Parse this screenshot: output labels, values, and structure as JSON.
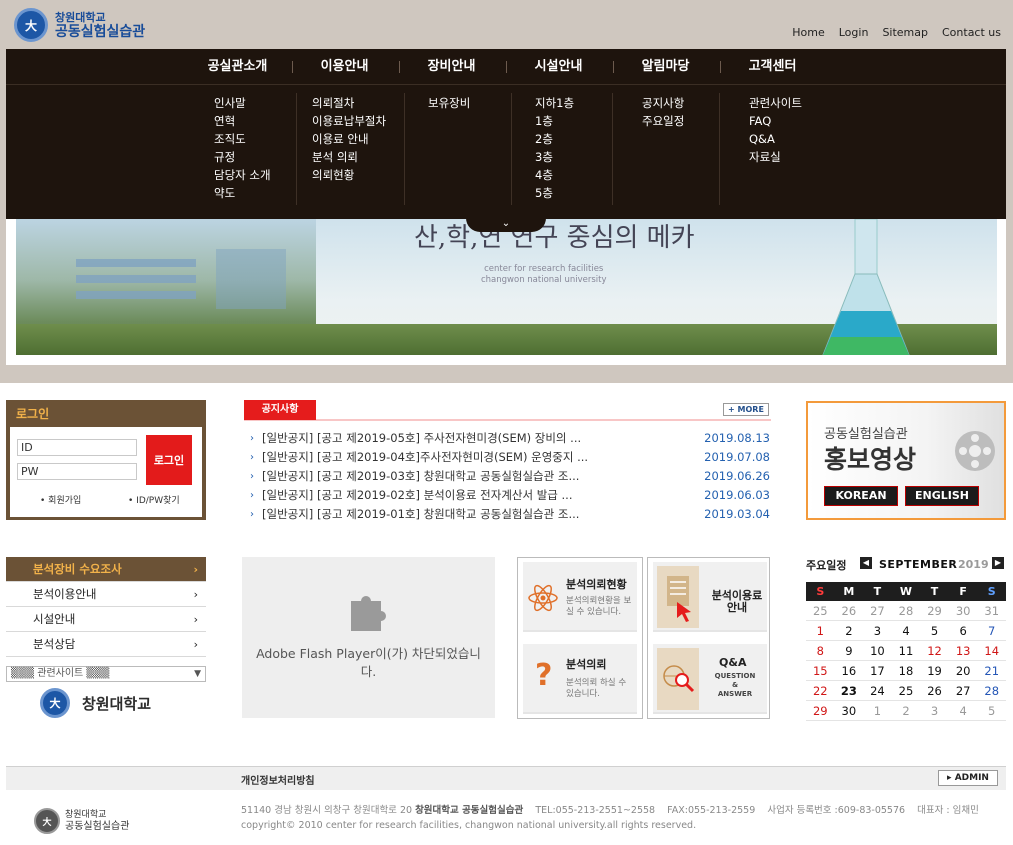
{
  "site": {
    "logo_line1": "창원대학교",
    "logo_line2": "공동실험실습관"
  },
  "util_links": [
    "Home",
    "Login",
    "Sitemap",
    "Contact us"
  ],
  "menu": [
    {
      "label": "공실관소개",
      "items": [
        "인사말",
        "연혁",
        "조직도",
        "규정",
        "담당자 소개",
        "약도"
      ]
    },
    {
      "label": "이용안내",
      "items": [
        "의뢰절차",
        "이용료납부절차",
        "이용료 안내",
        "분석 의뢰",
        "의뢰현황"
      ]
    },
    {
      "label": "장비안내",
      "items": [
        "보유장비"
      ]
    },
    {
      "label": "시설안내",
      "items": [
        "지하1층",
        "1층",
        "2층",
        "3층",
        "4층",
        "5층"
      ]
    },
    {
      "label": "알림마당",
      "items": [
        "공지사항",
        "주요일정"
      ]
    },
    {
      "label": "고객센터",
      "items": [
        "관련사이트",
        "FAQ",
        "Q&A",
        "자료실"
      ]
    }
  ],
  "banner": {
    "slogan": "산,학,연 연구 중심의 메카",
    "sub1": "center for research facilities",
    "sub2": "changwon national university"
  },
  "login": {
    "title": "로그인",
    "id_placeholder": "ID",
    "pw_placeholder": "PW",
    "button": "로그인",
    "join": "회원가입",
    "find": "ID/PW찾기"
  },
  "notice": {
    "tab": "공지사항",
    "more": "MORE",
    "items": [
      {
        "title": "[일반공지] [공고 제2019-05호] 주사전자현미경(SEM) 장비의 ...",
        "date": "2019.08.13"
      },
      {
        "title": "[일반공지] [공고 제2019-04호]주사전자현미경(SEM) 운영중지 ...",
        "date": "2019.07.08"
      },
      {
        "title": "[일반공지] [공고 제2019-03호] 창원대학교 공동실험실습관 조...",
        "date": "2019.06.26"
      },
      {
        "title": "[일반공지] [공고 제2019-02호] 분석이용료 전자계산서 발급 ...",
        "date": "2019.06.03"
      },
      {
        "title": "[일반공지] [공고 제2019-01호] 창원대학교 공동실험실습관 조...",
        "date": "2019.03.04"
      }
    ]
  },
  "promo": {
    "line1": "공동실험실습관",
    "line2": "홍보영상",
    "btn_korean": "KOREAN",
    "btn_english": "ENGLISH"
  },
  "left_menu": [
    {
      "label": "분석장비 수요조사"
    },
    {
      "label": "분석이용안내"
    },
    {
      "label": "시설안내"
    },
    {
      "label": "분석상담"
    }
  ],
  "related_select": "▒▒▒ 관련사이트 ▒▒▒",
  "univ_logo_text": "창원대학교",
  "flash_msg": "Adobe Flash Player이(가) 차단되었습니다.",
  "services": {
    "status": {
      "title": "분석의뢰현황",
      "desc": "분석의뢰현황을 보실 수 있습니다."
    },
    "request": {
      "title": "분석의뢰",
      "desc": "분석의뢰 하실 수 있습니다."
    },
    "fee": {
      "title": "분석이용료 안내"
    },
    "qa": {
      "title": "Q&A",
      "sub1": "QUESTION",
      "sub2": "&",
      "sub3": "ANSWER"
    }
  },
  "calendar": {
    "title": "주요일정",
    "month": "SEPTEMBER",
    "year": "2019",
    "weekdays": [
      "S",
      "M",
      "T",
      "W",
      "T",
      "F",
      "S"
    ],
    "weeks": [
      [
        "25",
        "26",
        "27",
        "28",
        "29",
        "30",
        "31"
      ],
      [
        "1",
        "2",
        "3",
        "4",
        "5",
        "6",
        "7"
      ],
      [
        "8",
        "9",
        "10",
        "11",
        "12",
        "13",
        "14"
      ],
      [
        "15",
        "16",
        "17",
        "18",
        "19",
        "20",
        "21"
      ],
      [
        "22",
        "23",
        "24",
        "25",
        "26",
        "27",
        "28"
      ],
      [
        "29",
        "30",
        "1",
        "2",
        "3",
        "4",
        "5"
      ]
    ]
  },
  "footer": {
    "privacy": "개인정보처리방침",
    "admin": "ADMIN",
    "logo_line1": "창원대학교",
    "logo_line2": "공동실험실습관",
    "addr_pre": "51140 경남 창원시 의창구 창원대학로 20 ",
    "addr_name": "창원대학교 공동실험실습관",
    "addr_post": "    TEL:055-213-2551~2558    FAX:055-213-2559    사업자 등록번호 :609-83-05576    대표자 : 임채민",
    "copyright": "copyright© 2010 center for research facilities, changwon national university.all rights reserved."
  },
  "colors": {
    "menu_bg": "#1e140d",
    "brown": "#6b5236",
    "accent_red": "#e51c1c",
    "link_blue": "#2461b0",
    "promo_border": "#f39a3b"
  }
}
